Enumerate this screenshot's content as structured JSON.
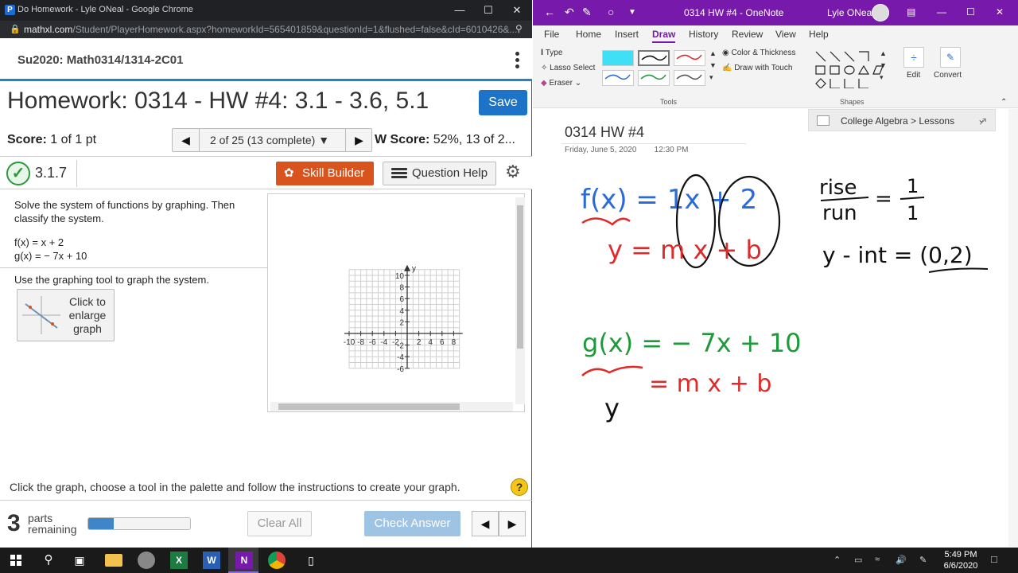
{
  "chrome": {
    "window_title": "Do Homework - Lyle ONeal - Google Chrome",
    "favicon_letter": "P",
    "url_host": "mathxl.com",
    "url_rest": "/Student/PlayerHomework.aspx?homeworkId=565401859&questionId=1&flushed=false&cId=6010426&..."
  },
  "mathxl": {
    "course": "Su2020: Math0314/1314-2C01",
    "title": "Homework: 0314 - HW #4: 3.1 - 3.6, 5.1",
    "save_label": "Save",
    "score_label": "Score:",
    "score_value": "1 of 1 pt",
    "nav_position": "2 of 25 (13 complete)",
    "hw_score_label": "W Score:",
    "hw_score_value": "52%, 13 of 2...",
    "question_number": "3.1.7",
    "skill_builder": "Skill Builder",
    "question_help": "Question Help",
    "question_text": "Solve the system of functions by graphing. Then classify the system.",
    "f": "f(x) = x + 2",
    "g": "g(x) = − 7x + 10",
    "instruction": "Use the graphing tool to graph the system.",
    "enlarge_label": "Click to enlarge graph",
    "footer_instruction": "Click the graph, choose a tool in the palette and follow the instructions to create your graph.",
    "parts_count": "3",
    "parts_label_1": "parts",
    "parts_label_2": "remaining",
    "progress_fraction": 0.25,
    "clear_all": "Clear All",
    "check_answer": "Check Answer",
    "graph": {
      "y_axis_label": "y",
      "x_ticks": [
        "-10",
        "-8",
        "-6",
        "-4",
        "-2",
        "2",
        "4",
        "6",
        "8"
      ],
      "y_ticks": [
        "10",
        "8",
        "6",
        "4",
        "2",
        "-2",
        "-4",
        "-6"
      ]
    }
  },
  "onenote": {
    "doc_title": "0314 HW #4  -  OneNote",
    "user": "Lyle ONeal",
    "tabs": [
      "File",
      "Home",
      "Insert",
      "Draw",
      "History",
      "Review",
      "View",
      "Help"
    ],
    "active_tab": "Draw",
    "tools": {
      "type": "Type",
      "lasso": "Lasso Select",
      "eraser": "Eraser",
      "color_thickness": "Color & Thickness",
      "draw_touch": "Draw with Touch",
      "group_tools": "Tools",
      "group_shapes": "Shapes",
      "edit": "Edit",
      "convert": "Convert"
    },
    "page_title": "0314 HW #4",
    "page_date": "Friday, June 5, 2020",
    "page_time": "12:30 PM",
    "notebook": "College Algebra > Lessons",
    "ink": {
      "fx": "f(x) = 1x + 2",
      "y_mxb": "y  =  m x + b",
      "rise": "rise",
      "run": "run",
      "eq": "=",
      "one_top": "1",
      "one_bot": "1",
      "yint": "y - int = (0,2)",
      "gx": "g(x) = − 7x + 10",
      "y2": "y",
      "mxb2": "=  m x + b"
    }
  },
  "taskbar": {
    "time": "5:49 PM",
    "date": "6/6/2020"
  }
}
